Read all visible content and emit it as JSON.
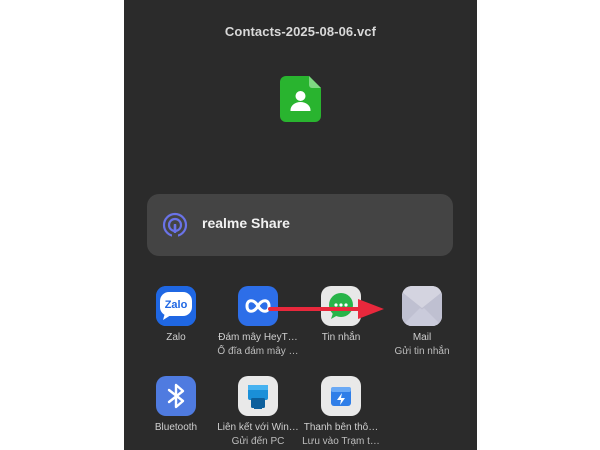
{
  "file": {
    "name": "Contacts-2025-08-06.vcf",
    "icon": "contact-file-icon",
    "icon_color": "#29b42f"
  },
  "share": {
    "label": "realme Share",
    "icon": "realme-share-icon",
    "icon_color": "#6a73e8"
  },
  "apps": [
    {
      "label": "Zalo",
      "sub": "",
      "icon": "zalo-icon",
      "color": "#1f67e3"
    },
    {
      "label": "Đám mây HeyT…",
      "sub": "Ổ đĩa đám mây …",
      "icon": "cloud-infinity-icon",
      "color": "#2d6ee8"
    },
    {
      "label": "Tin nhắn",
      "sub": "",
      "icon": "messages-icon",
      "color": "#e8e8e8"
    },
    {
      "label": "Mail",
      "sub": "Gửi tin nhắn",
      "icon": "mail-icon",
      "color": "#d6d6e2"
    },
    {
      "label": "Bluetooth",
      "sub": "",
      "icon": "bluetooth-icon",
      "color": "#4f7be0"
    },
    {
      "label": "Liên kết với Win…",
      "sub": "Gửi đến PC",
      "icon": "windows-link-icon",
      "color": "#e9e9e9"
    },
    {
      "label": "Thanh bên thô…",
      "sub": "Lưu vào Trạm t…",
      "icon": "sidebar-station-icon",
      "color": "#e9e9e9"
    }
  ],
  "annotation": {
    "arrow_color": "#e8283c",
    "icon": "red-arrow-icon"
  }
}
